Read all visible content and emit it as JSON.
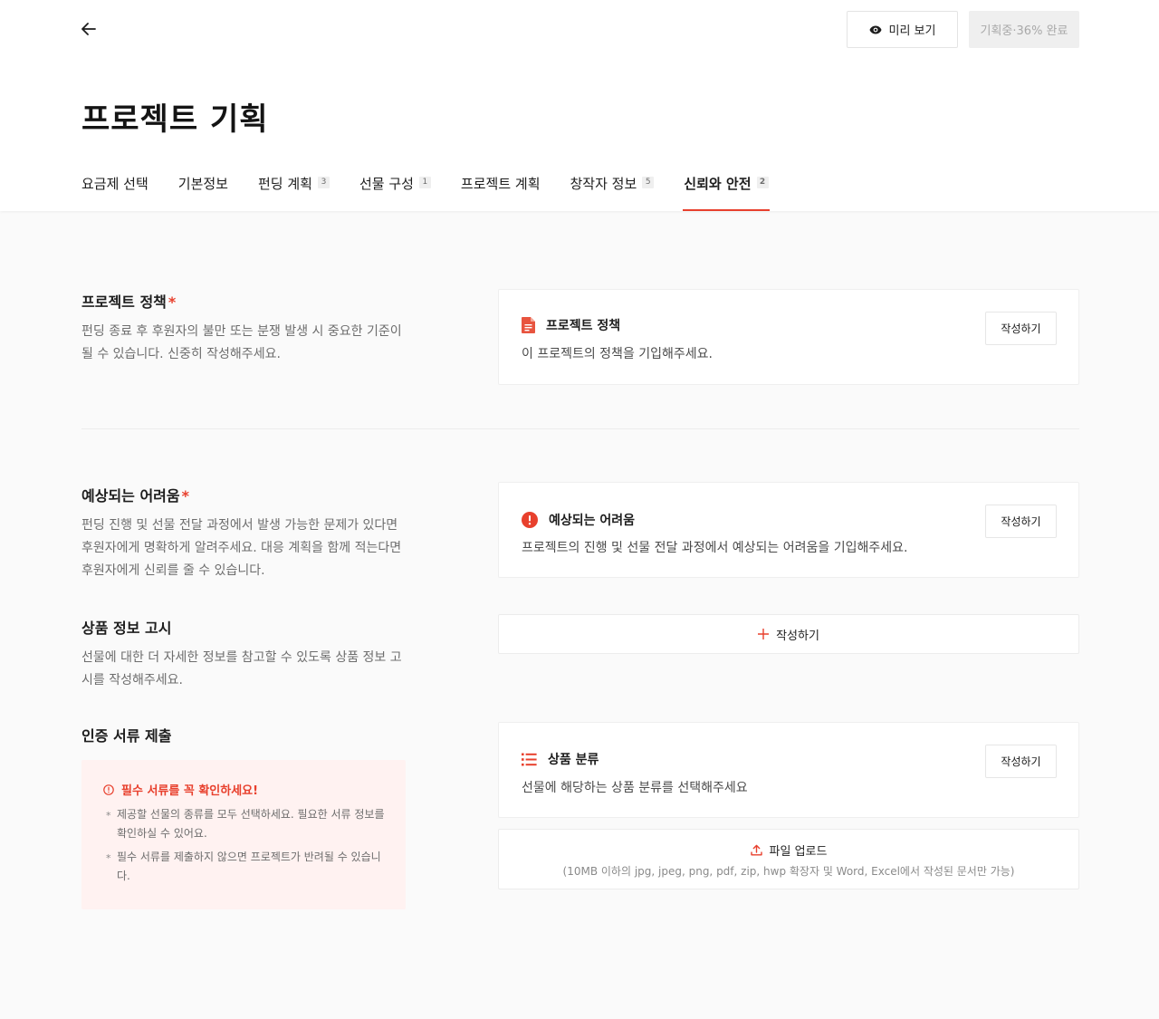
{
  "header": {
    "preview_label": "미리 보기",
    "status_label": "기획중·36% 완료",
    "title": "프로젝트 기획"
  },
  "tabs": [
    {
      "label": "요금제 선택",
      "count": ""
    },
    {
      "label": "기본정보",
      "count": ""
    },
    {
      "label": "펀딩 계획",
      "count": "3"
    },
    {
      "label": "선물 구성",
      "count": "1"
    },
    {
      "label": "프로젝트 계획",
      "count": ""
    },
    {
      "label": "창작자 정보",
      "count": "5"
    },
    {
      "label": "신뢰와 안전",
      "count": "2",
      "active": true
    }
  ],
  "sections": {
    "policy": {
      "title": "프로젝트 정책",
      "required_mark": "*",
      "desc": "펀딩 종료 후 후원자의 불만 또는 분쟁 발생 시 중요한 기준이 될 수 있습니다. 신중히 작성해주세요.",
      "card_title": "프로젝트 정책",
      "card_desc": "이 프로젝트의 정책을 기입해주세요.",
      "button": "작성하기"
    },
    "difficulty": {
      "title": "예상되는 어려움",
      "required_mark": "*",
      "desc": "펀딩 진행 및 선물 전달 과정에서 발생 가능한 문제가 있다면 후원자에게 명확하게 알려주세요. 대응 계획을 함께 적는다면 후원자에게 신뢰를 줄 수 있습니다.",
      "card_title": "예상되는 어려움",
      "card_desc": "프로젝트의 진행 및 선물 전달 과정에서 예상되는 어려움을 기입해주세요.",
      "button": "작성하기"
    },
    "product_info": {
      "title": "상품 정보 고시",
      "desc": "선물에 대한 더 자세한 정보를 참고할 수 있도록 상품 정보 고시를 작성해주세요.",
      "add_label": "작성하기"
    },
    "certification": {
      "title": "인증 서류 제출",
      "notice_title": "필수 서류를 꼭 확인하세요!",
      "notice_items": [
        "제공할 선물의 종류를 모두 선택하세요. 필요한 서류 정보를 확인하실 수 있어요.",
        "필수 서류를 제출하지 않으면 프로젝트가 반려될 수 있습니다."
      ],
      "card_title": "상품 분류",
      "card_desc": "선물에 해당하는 상품 분류를 선택해주세요",
      "button": "작성하기",
      "upload_label": "파일 업로드",
      "upload_hint": "(10MB 이하의 jpg, jpeg, png, pdf, zip, hwp 확장자 및 Word, Excel에서 작성된 문서만 가능)"
    }
  },
  "colors": {
    "accent": "#e8402d",
    "notice_bg": "#fff2f1"
  },
  "icons": [
    "back-arrow-icon",
    "eye-icon",
    "document-icon",
    "alert-icon",
    "list-icon",
    "plus-icon",
    "upload-icon",
    "info-icon"
  ]
}
